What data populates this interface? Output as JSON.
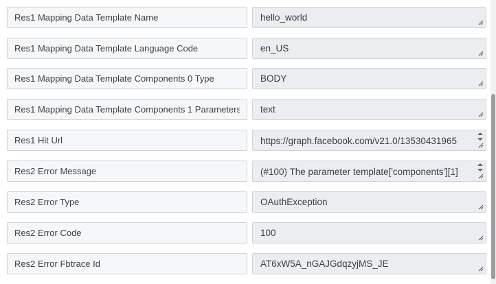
{
  "fields": [
    {
      "label": "Res1 Mapping Data Template Name",
      "value": "hello_world"
    },
    {
      "label": "Res1 Mapping Data Template Language Code",
      "value": "en_US"
    },
    {
      "label": "Res1 Mapping Data Template Components 0 Type",
      "value": "BODY"
    },
    {
      "label": "Res1 Mapping Data Template Components 1 Parameters",
      "value": "text"
    },
    {
      "label": "Res1 Hit Url",
      "value": "https://graph.facebook.com/v21.0/13530431965"
    },
    {
      "label": "Res2 Error Message",
      "value": "(#100) The parameter template['components'][1]"
    },
    {
      "label": "Res2 Error Type",
      "value": "OAuthException"
    },
    {
      "label": "Res2 Error Code",
      "value": "100"
    },
    {
      "label": "Res2 Error Fbtrace Id",
      "value": "AT6xW5A_nGAJGdqzyjMS_JE"
    }
  ]
}
